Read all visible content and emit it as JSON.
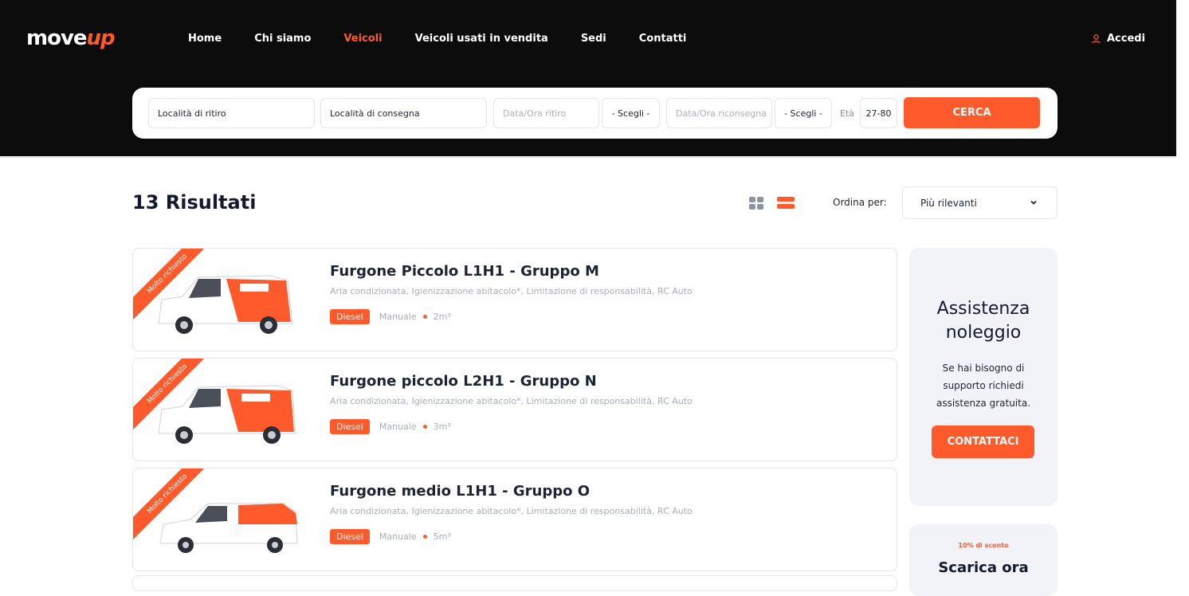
{
  "brand": {
    "logo_part1": "move",
    "logo_part2": "up",
    "accent": "#ff5a2c"
  },
  "nav": {
    "items": [
      {
        "label": "Home",
        "active": false
      },
      {
        "label": "Chi siamo",
        "active": false
      },
      {
        "label": "Veicoli",
        "active": true
      },
      {
        "label": "Veicoli usati in vendita",
        "active": false
      },
      {
        "label": "Sedi",
        "active": false
      },
      {
        "label": "Contatti",
        "active": false
      }
    ],
    "login_label": "Accedi",
    "login_icon": "user-icon"
  },
  "search": {
    "pickup_location": "Località di ritiro",
    "dropoff_location": "Località di consegna",
    "pickup_datetime_placeholder": "Data/Ora ritiro",
    "pickup_time": "- Scegli -",
    "return_datetime_placeholder": "Data/Ora riconsegna",
    "return_time": "- Scegli -",
    "age_label": "Età",
    "age_value": "27-80",
    "submit_label": "CERCA"
  },
  "results": {
    "title": "13 Risultati",
    "sort_label": "Ordina per:",
    "sort_value": "Più rilevanti",
    "view_modes": [
      "grid-view-icon",
      "list-view-icon"
    ],
    "active_view": "list"
  },
  "vehicles": [
    {
      "badge": "Molto richiesto",
      "name": "Furgone Piccolo L1H1 - Gruppo M",
      "features": "Aria condizionata,  Igienizzazione abitacolo*,  Limitazione di responsabilità,  RC Auto",
      "fuel": "Diesel",
      "transmission": "Manuale",
      "volume": "2m³"
    },
    {
      "badge": "Molto richiesto",
      "name": "Furgone piccolo L2H1 - Gruppo N",
      "features": "Aria condizionata,  Igienizzazione abitacolo*,  Limitazione di responsabilità,  RC Auto",
      "fuel": "Diesel",
      "transmission": "Manuale",
      "volume": "3m³"
    },
    {
      "badge": "Molto richiesto",
      "name": "Furgone medio L1H1 - Gruppo O",
      "features": "Aria condizionata,  Igienizzazione abitacolo*,  Limitazione di responsabilità,  RC Auto",
      "fuel": "Diesel",
      "transmission": "Manuale",
      "volume": "5m³"
    }
  ],
  "sidebar": {
    "support_title_1": "Assistenza",
    "support_title_2": "noleggio",
    "support_text": "Se hai bisogno di supporto richiedi assistenza gratuita.",
    "support_button": "CONTATTACI",
    "app_discount": "10% di sconto",
    "app_title": "Scarica ora"
  }
}
